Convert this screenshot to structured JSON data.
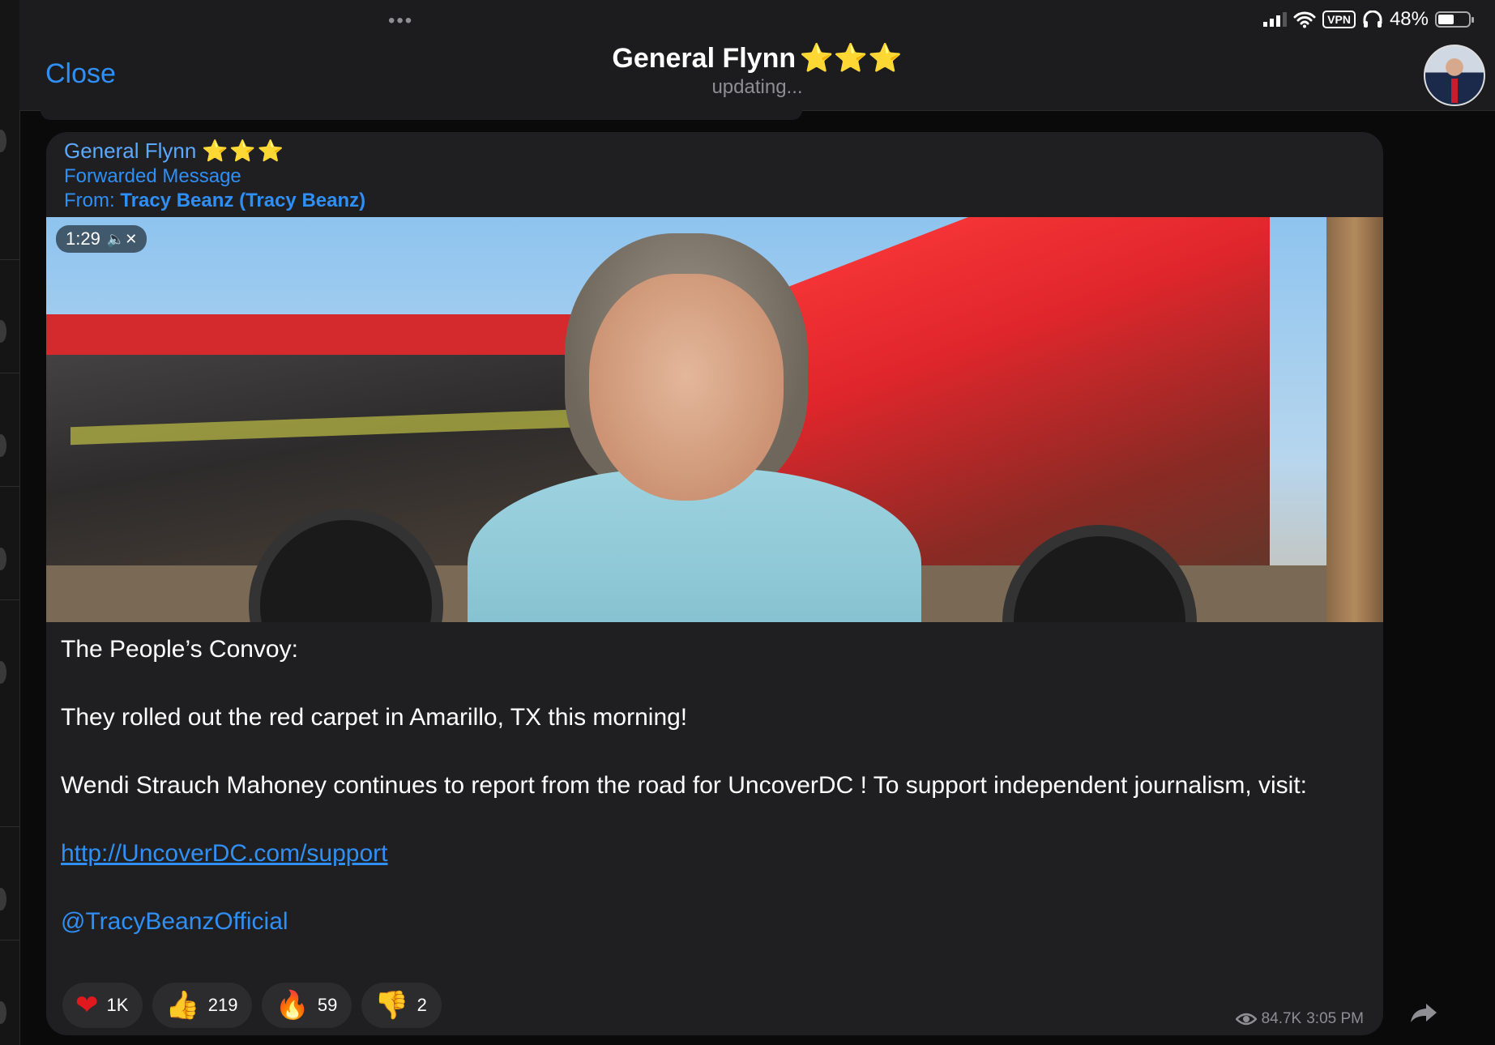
{
  "status_bar": {
    "vpn_label": "VPN",
    "battery": "48%"
  },
  "header": {
    "dots": "•••",
    "close_label": "Close",
    "title": "General Flynn",
    "title_stars": "⭐⭐⭐",
    "subtitle": "updating..."
  },
  "message": {
    "sender": "General Flynn",
    "sender_stars": "⭐⭐⭐",
    "forwarded_label": "Forwarded Message",
    "from_prefix": "From: ",
    "from_name": "Tracy Beanz (Tracy Beanz)",
    "video_duration": "1:29",
    "paragraphs": [
      "The People’s Convoy:",
      "They rolled out the red carpet in Amarillo, TX this morning!",
      "Wendi Strauch Mahoney continues to report from the road for UncoverDC ! To support independent journalism, visit:"
    ],
    "link": "http://UncoverDC.com/support",
    "mention": "@TracyBeanzOfficial",
    "views": "84.7K",
    "time": "3:05 PM"
  },
  "reactions": [
    {
      "emoji": "❤",
      "count": "1K",
      "color": "#e0191e"
    },
    {
      "emoji": "👍",
      "count": "219",
      "color": "#f4b400"
    },
    {
      "emoji": "🔥",
      "count": "59",
      "color": "#ff6a00"
    },
    {
      "emoji": "👎",
      "count": "2",
      "color": "#f4b400"
    }
  ],
  "colors": {
    "accent": "#2f8ff5",
    "background": "#0a0a0a",
    "bubble": "#1f1f21",
    "star": "#f5c518"
  }
}
